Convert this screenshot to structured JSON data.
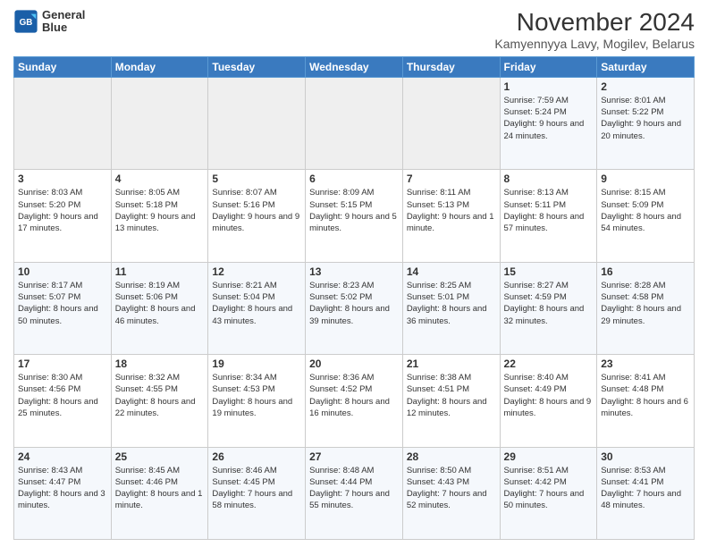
{
  "header": {
    "logo_line1": "General",
    "logo_line2": "Blue",
    "title": "November 2024",
    "subtitle": "Kamyennyya Lavy, Mogilev, Belarus"
  },
  "weekdays": [
    "Sunday",
    "Monday",
    "Tuesday",
    "Wednesday",
    "Thursday",
    "Friday",
    "Saturday"
  ],
  "weeks": [
    [
      {
        "day": "",
        "info": ""
      },
      {
        "day": "",
        "info": ""
      },
      {
        "day": "",
        "info": ""
      },
      {
        "day": "",
        "info": ""
      },
      {
        "day": "",
        "info": ""
      },
      {
        "day": "1",
        "info": "Sunrise: 7:59 AM\nSunset: 5:24 PM\nDaylight: 9 hours\nand 24 minutes."
      },
      {
        "day": "2",
        "info": "Sunrise: 8:01 AM\nSunset: 5:22 PM\nDaylight: 9 hours\nand 20 minutes."
      }
    ],
    [
      {
        "day": "3",
        "info": "Sunrise: 8:03 AM\nSunset: 5:20 PM\nDaylight: 9 hours\nand 17 minutes."
      },
      {
        "day": "4",
        "info": "Sunrise: 8:05 AM\nSunset: 5:18 PM\nDaylight: 9 hours\nand 13 minutes."
      },
      {
        "day": "5",
        "info": "Sunrise: 8:07 AM\nSunset: 5:16 PM\nDaylight: 9 hours\nand 9 minutes."
      },
      {
        "day": "6",
        "info": "Sunrise: 8:09 AM\nSunset: 5:15 PM\nDaylight: 9 hours\nand 5 minutes."
      },
      {
        "day": "7",
        "info": "Sunrise: 8:11 AM\nSunset: 5:13 PM\nDaylight: 9 hours\nand 1 minute."
      },
      {
        "day": "8",
        "info": "Sunrise: 8:13 AM\nSunset: 5:11 PM\nDaylight: 8 hours\nand 57 minutes."
      },
      {
        "day": "9",
        "info": "Sunrise: 8:15 AM\nSunset: 5:09 PM\nDaylight: 8 hours\nand 54 minutes."
      }
    ],
    [
      {
        "day": "10",
        "info": "Sunrise: 8:17 AM\nSunset: 5:07 PM\nDaylight: 8 hours\nand 50 minutes."
      },
      {
        "day": "11",
        "info": "Sunrise: 8:19 AM\nSunset: 5:06 PM\nDaylight: 8 hours\nand 46 minutes."
      },
      {
        "day": "12",
        "info": "Sunrise: 8:21 AM\nSunset: 5:04 PM\nDaylight: 8 hours\nand 43 minutes."
      },
      {
        "day": "13",
        "info": "Sunrise: 8:23 AM\nSunset: 5:02 PM\nDaylight: 8 hours\nand 39 minutes."
      },
      {
        "day": "14",
        "info": "Sunrise: 8:25 AM\nSunset: 5:01 PM\nDaylight: 8 hours\nand 36 minutes."
      },
      {
        "day": "15",
        "info": "Sunrise: 8:27 AM\nSunset: 4:59 PM\nDaylight: 8 hours\nand 32 minutes."
      },
      {
        "day": "16",
        "info": "Sunrise: 8:28 AM\nSunset: 4:58 PM\nDaylight: 8 hours\nand 29 minutes."
      }
    ],
    [
      {
        "day": "17",
        "info": "Sunrise: 8:30 AM\nSunset: 4:56 PM\nDaylight: 8 hours\nand 25 minutes."
      },
      {
        "day": "18",
        "info": "Sunrise: 8:32 AM\nSunset: 4:55 PM\nDaylight: 8 hours\nand 22 minutes."
      },
      {
        "day": "19",
        "info": "Sunrise: 8:34 AM\nSunset: 4:53 PM\nDaylight: 8 hours\nand 19 minutes."
      },
      {
        "day": "20",
        "info": "Sunrise: 8:36 AM\nSunset: 4:52 PM\nDaylight: 8 hours\nand 16 minutes."
      },
      {
        "day": "21",
        "info": "Sunrise: 8:38 AM\nSunset: 4:51 PM\nDaylight: 8 hours\nand 12 minutes."
      },
      {
        "day": "22",
        "info": "Sunrise: 8:40 AM\nSunset: 4:49 PM\nDaylight: 8 hours\nand 9 minutes."
      },
      {
        "day": "23",
        "info": "Sunrise: 8:41 AM\nSunset: 4:48 PM\nDaylight: 8 hours\nand 6 minutes."
      }
    ],
    [
      {
        "day": "24",
        "info": "Sunrise: 8:43 AM\nSunset: 4:47 PM\nDaylight: 8 hours\nand 3 minutes."
      },
      {
        "day": "25",
        "info": "Sunrise: 8:45 AM\nSunset: 4:46 PM\nDaylight: 8 hours\nand 1 minute."
      },
      {
        "day": "26",
        "info": "Sunrise: 8:46 AM\nSunset: 4:45 PM\nDaylight: 7 hours\nand 58 minutes."
      },
      {
        "day": "27",
        "info": "Sunrise: 8:48 AM\nSunset: 4:44 PM\nDaylight: 7 hours\nand 55 minutes."
      },
      {
        "day": "28",
        "info": "Sunrise: 8:50 AM\nSunset: 4:43 PM\nDaylight: 7 hours\nand 52 minutes."
      },
      {
        "day": "29",
        "info": "Sunrise: 8:51 AM\nSunset: 4:42 PM\nDaylight: 7 hours\nand 50 minutes."
      },
      {
        "day": "30",
        "info": "Sunrise: 8:53 AM\nSunset: 4:41 PM\nDaylight: 7 hours\nand 48 minutes."
      }
    ]
  ]
}
